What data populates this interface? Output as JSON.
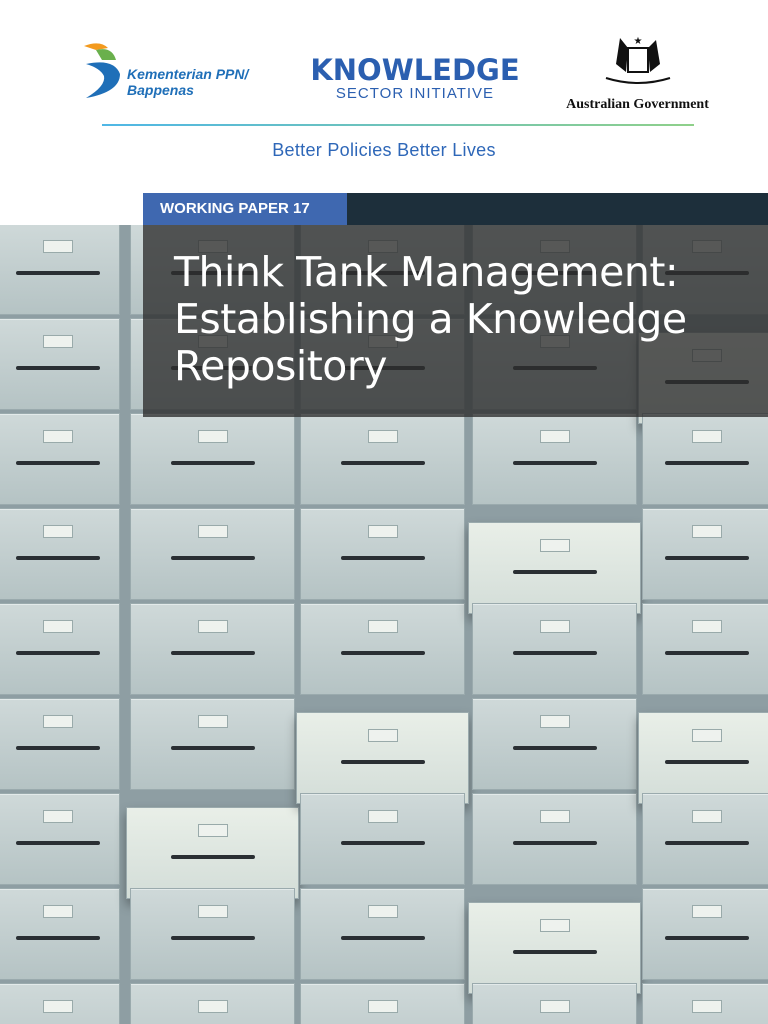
{
  "logos": {
    "bappenas": {
      "line1": "Kementerian PPN/",
      "line2": "Bappenas"
    },
    "ksi": {
      "line1": "KNOWLEDGE",
      "line2": "SECTOR INITIATIVE"
    },
    "australia": {
      "text": "Australian Government"
    }
  },
  "tagline": "Better Policies Better Lives",
  "series_label": "WORKING PAPER 17",
  "title": "Think Tank Management: Establishing a Knowledge Repository",
  "colors": {
    "accent_blue": "#3f68b0",
    "dark_bar": "#1d2f3b",
    "tagline": "#2e67b8"
  }
}
